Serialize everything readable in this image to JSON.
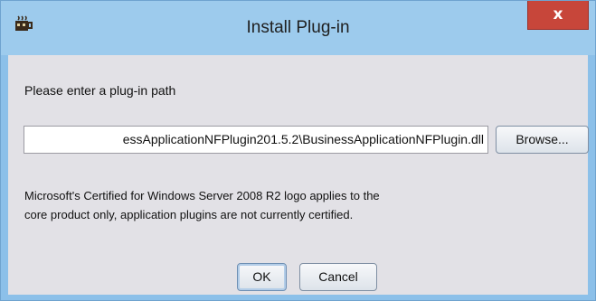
{
  "window": {
    "title": "Install Plug-in",
    "app_icon": "java-cup-icon",
    "close_icon": "close-icon",
    "close_glyph": "x"
  },
  "dialog": {
    "prompt_label": "Please enter a plug-in path",
    "path_input_value": "essApplicationNFPlugin201.5.2\\BusinessApplicationNFPlugin.dll",
    "browse_label": "Browse...",
    "notice_lines": [
      "Microsoft's Certified for Windows Server 2008 R2 logo applies to the",
      "core product only, application plugins are not currently certified."
    ],
    "ok_label": "OK",
    "cancel_label": "Cancel"
  },
  "colors": {
    "titlebar": "#9dcbed",
    "close_button": "#c7463a",
    "client_background": "#e2e1e6"
  }
}
